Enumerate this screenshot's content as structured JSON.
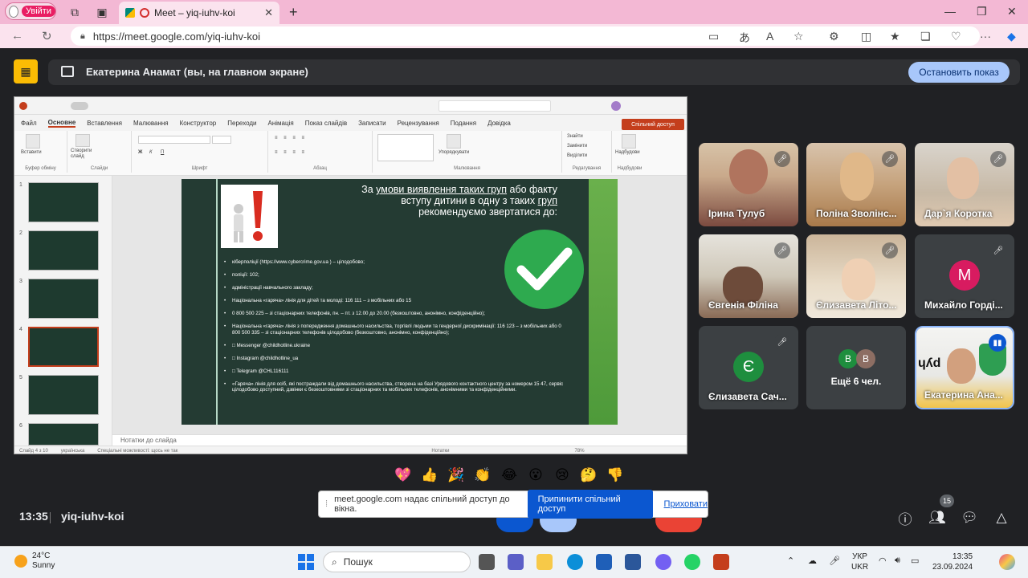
{
  "browser": {
    "profile_label": "Увійти",
    "tab_title": "Meet – yiq-iuhv-koi",
    "url": "https://meet.google.com/yiq-iuhv-koi"
  },
  "meet": {
    "presenter_text": "Екатерина Анамат (вы, на главном экране)",
    "stop_presentation": "Остановить показ",
    "time": "13:35",
    "meeting_code": "yiq-iuhv-koi",
    "participants_badge": "15",
    "share_notice": {
      "text": "meet.google.com надає спільний доступ до вікна.",
      "stop_button": "Припинити спільний доступ",
      "hide_link": "Приховати"
    },
    "reactions": [
      "💖",
      "👍",
      "🎉",
      "👏",
      "😂",
      "😮",
      "😢",
      "🤔",
      "👎"
    ],
    "participants": [
      {
        "name": "Ірина Тулуб"
      },
      {
        "name": "Поліна Зволінс..."
      },
      {
        "name": "Дар`я Коротка"
      },
      {
        "name": "Євгенія Філіна"
      },
      {
        "name": "Єлизавета Літо..."
      },
      {
        "name": "Михайло Горді...",
        "initial": "М",
        "color": "#d81b60"
      },
      {
        "name": "Єлизавета Сач...",
        "initial": "Є",
        "color": "#1e8e3e"
      },
      {
        "name": "Ещё 6 чел.",
        "initials": [
          "В",
          "В"
        ],
        "colors": [
          "#1e8e3e",
          "#8d6e63"
        ]
      },
      {
        "name": "Екатерина Ана..."
      }
    ]
  },
  "ppt": {
    "menu": [
      "Файл",
      "Основне",
      "Вставлення",
      "Малювання",
      "Конструктор",
      "Переходи",
      "Анімація",
      "Показ слайдів",
      "Записати",
      "Рецензування",
      "Подання",
      "Довідка"
    ],
    "share_button": "Спільний доступ",
    "ribbon_groups": [
      "Буфер обміну",
      "Слайди",
      "Шрифт",
      "Абзац",
      "Малювання",
      "Редагування",
      "Надбудови"
    ],
    "ribbon_items": {
      "paste": "Вставити",
      "new_slide": "Створити слайд",
      "arrange": "Упорядкувати",
      "find": "Знайти",
      "replace": "Замінити",
      "select": "Виділити",
      "addins": "Надбудови"
    },
    "notes_placeholder": "Нотатки до слайда",
    "status_slide": "Слайд 4 з 10",
    "status_lang": "українська",
    "status_accessibility": "Спеціальні можливості: щось не так",
    "status_notes": "Нотатки",
    "zoom": "78%",
    "slide_numbers": [
      "1",
      "2",
      "3",
      "4",
      "5",
      "6"
    ]
  },
  "slide": {
    "heading_line1_pre": "За ",
    "heading_line1_u": "умови виявлення таких груп",
    "heading_line1_post": " або факту",
    "heading_line2_pre": "вступу дитини в одну з таких ",
    "heading_line2_u": "груп",
    "heading_line3": "рекомендуємо звертатися до:",
    "bullets": [
      "кіберполіції (https://www.cybercrime.gov.ua ) – цілодобово;",
      "поліції: 102;",
      "адміністрації навчального закладу;",
      "Національна «гаряча» лінія для дітей та молоді: 116 111 – з мобільних або 15",
      "0 800 500 225 – зі стаціонарних телефонів, пн. – пт. з 12.00 до 20.00 (безкоштовно, анонімно, конфіденційно);",
      "Національна «гаряча» лінія з попередження домашнього насильства, торгівлі людьми та гендерної дискримінації: 116 123 – з мобільних або 0 800 500 335 – зі стаціонарних телефонів цілодобово (безкоштовно, анонімно, конфіденційно);",
      "□ Messenger @childhotline.ukraine",
      "□ Instagram @childhotline_ua",
      "□ Telegram @CHL116111",
      "«Гаряча» лінія для осіб, які постраждали від домашнього насильства, створена на базі Урядового контактного центру за номером 15 47, сервіс цілодобово доступний, дзвінки є безкоштовними зі стаціонарних та мобільних телефонів, анонімними та конфіденційними."
    ]
  },
  "taskbar": {
    "temp": "24°C",
    "weather": "Sunny",
    "search": "Пошук",
    "lang1": "УКР",
    "lang2": "UKR",
    "clock_time": "13:35",
    "clock_date": "23.09.2024"
  }
}
